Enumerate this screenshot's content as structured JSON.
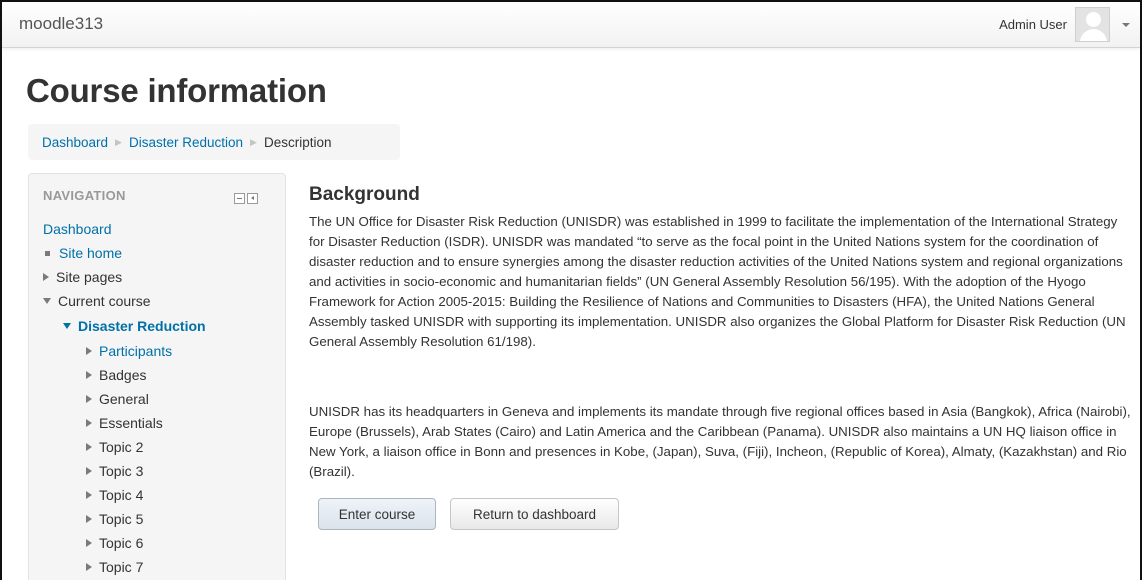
{
  "navbar": {
    "brand": "moodle313",
    "user_name": "Admin User"
  },
  "page": {
    "title": "Course information"
  },
  "breadcrumb": [
    {
      "label": "Dashboard"
    },
    {
      "label": "Disaster Reduction"
    },
    {
      "label": "Description"
    }
  ],
  "navigation": {
    "header": "NAVIGATION",
    "items": [
      {
        "label": "Dashboard"
      },
      {
        "label": "Site home"
      },
      {
        "label": "Site pages"
      },
      {
        "label": "Current course"
      },
      {
        "label": "Disaster Reduction"
      },
      {
        "label": "Participants"
      },
      {
        "label": "Badges"
      },
      {
        "label": "General"
      },
      {
        "label": "Essentials"
      },
      {
        "label": "Topic 2"
      },
      {
        "label": "Topic 3"
      },
      {
        "label": "Topic 4"
      },
      {
        "label": "Topic 5"
      },
      {
        "label": "Topic 6"
      },
      {
        "label": "Topic 7"
      }
    ]
  },
  "content": {
    "heading": "Background",
    "paragraphs": [
      "The UN Office for Disaster Risk Reduction (UNISDR) was established in 1999 to facilitate the implementation of the International Strategy for Disaster Reduction (ISDR). UNISDR was mandated “to serve as the focal point in the United Nations system for the coordination of disaster reduction and to ensure synergies among the disaster reduction activities of the United Nations system and regional organizations and activities in socio-economic and humanitarian fields” (UN General Assembly Resolution 56/195). With the adoption of the Hyogo Framework for Action 2005-2015: Building the Resilience of Nations and Communities to Disasters (HFA), the United Nations General Assembly tasked UNISDR with supporting its implementation. UNISDR also organizes the Global Platform for Disaster Risk Reduction (UN General Assembly Resolution 61/198).",
      "UNISDR has its headquarters in Geneva and implements its mandate through five regional offices based in Asia (Bangkok), Africa (Nairobi), Europe (Brussels), Arab States (Cairo) and Latin America and the Caribbean (Panama). UNISDR also maintains a UN HQ liaison office in New York, a liaison office in Bonn and presences in Kobe, (Japan), Suva, (Fiji), Incheon, (Republic of Korea), Almaty, (Kazakhstan) and Rio (Brazil)."
    ],
    "enter_button": "Enter course",
    "return_button": "Return to dashboard"
  },
  "colors": {
    "link": "#0070a8",
    "text": "#333333",
    "muted": "#999999"
  }
}
